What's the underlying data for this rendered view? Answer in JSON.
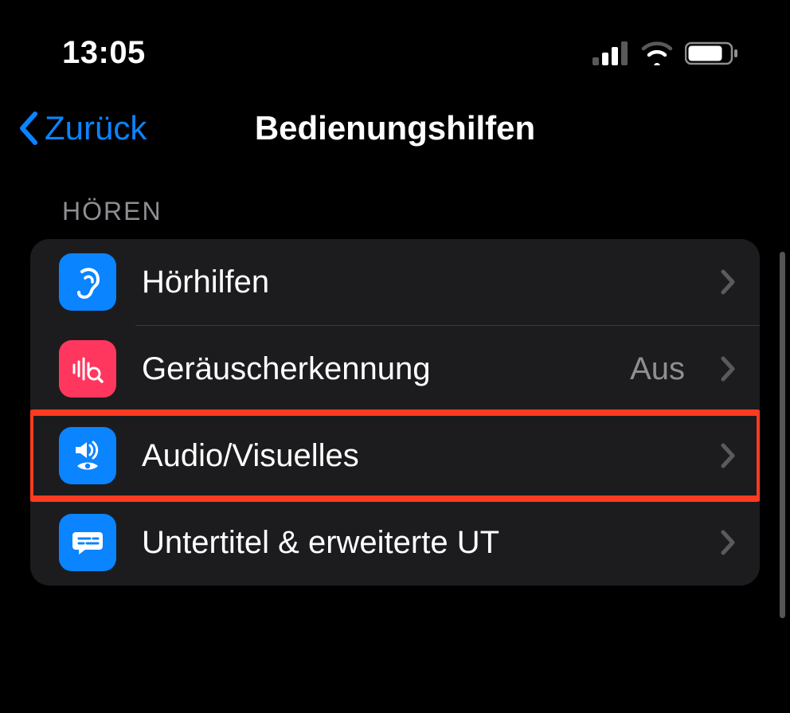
{
  "status": {
    "time": "13:05"
  },
  "nav": {
    "back_label": "Zurück",
    "title": "Bedienungshilfen"
  },
  "section": {
    "header": "HÖREN"
  },
  "rows": {
    "hearing_aids": {
      "label": "Hörhilfen"
    },
    "sound_recog": {
      "label": "Geräuscherkennung",
      "value": "Aus"
    },
    "audio_visual": {
      "label": "Audio/Visuelles"
    },
    "subtitles": {
      "label": "Untertitel & erweiterte UT"
    }
  }
}
